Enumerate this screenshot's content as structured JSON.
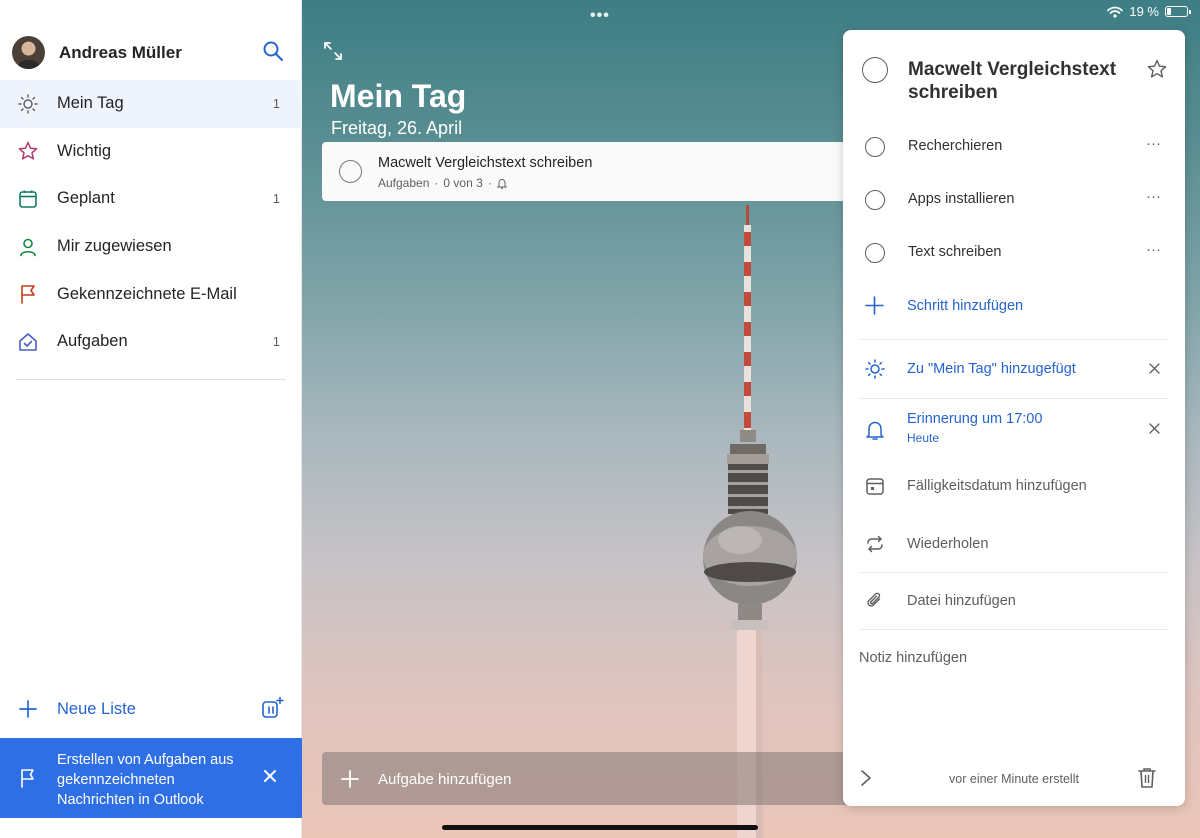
{
  "status_bar": {
    "battery": "19 %",
    "dots": "•••"
  },
  "sidebar": {
    "user_name": "Andreas Müller",
    "items": [
      {
        "label": "Mein Tag",
        "count": "1",
        "icon": "sun-icon",
        "color": "#605e5c"
      },
      {
        "label": "Wichtig",
        "count": "",
        "icon": "star-icon",
        "color": "#b33c6e"
      },
      {
        "label": "Geplant",
        "count": "1",
        "icon": "calendar-icon",
        "color": "#117865"
      },
      {
        "label": "Mir zugewiesen",
        "count": "",
        "icon": "person-icon",
        "color": "#13883d"
      },
      {
        "label": "Gekennzeichnete E-Mail",
        "count": "",
        "icon": "flag-icon",
        "color": "#c43e1c"
      },
      {
        "label": "Aufgaben",
        "count": "1",
        "icon": "home-check-icon",
        "color": "#4a5ccf"
      }
    ],
    "new_list_label": "Neue Liste",
    "banner": {
      "text": "Erstellen von Aufgaben aus gekennzeichneten Nachrichten in Outlook",
      "color": "#2f6fe5"
    }
  },
  "main": {
    "title": "Mein Tag",
    "date": "Freitag, 26. April",
    "task": {
      "title": "Macwelt Vergleichstext schreiben",
      "list": "Aufgaben",
      "separator": "·",
      "steps_progress": "0 von 3"
    },
    "add_task_label": "Aufgabe hinzufügen"
  },
  "detail": {
    "title": "Macwelt Vergleichstext schreiben",
    "steps": [
      {
        "label": "Recherchieren"
      },
      {
        "label": "Apps installieren"
      },
      {
        "label": "Text schreiben"
      }
    ],
    "step_more": "···",
    "add_step_label": "Schritt hinzufügen",
    "my_day_label": "Zu \"Mein Tag\" hinzugefügt",
    "reminder_label": "Erinnerung um 17:00",
    "reminder_sub": "Heute",
    "due_label": "Fälligkeitsdatum hinzufügen",
    "repeat_label": "Wiederholen",
    "file_label": "Datei hinzufügen",
    "note_placeholder": "Notiz hinzufügen",
    "created": "vor einer Minute erstellt",
    "accent": "#2564cf"
  }
}
